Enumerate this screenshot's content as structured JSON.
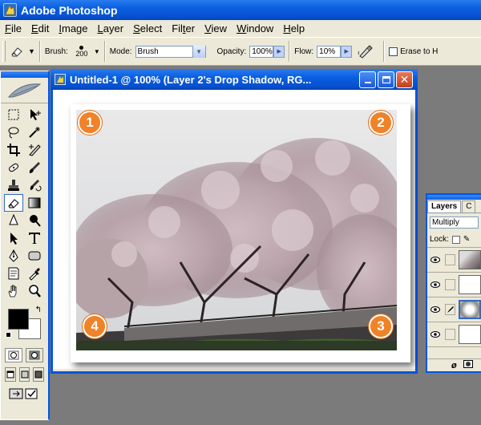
{
  "app": {
    "title": "Adobe Photoshop"
  },
  "menu": [
    {
      "label": "File",
      "u": "F",
      "rest": "ile"
    },
    {
      "label": "Edit",
      "u": "E",
      "rest": "dit"
    },
    {
      "label": "Image",
      "u": "I",
      "rest": "mage"
    },
    {
      "label": "Layer",
      "u": "L",
      "rest": "ayer"
    },
    {
      "label": "Select",
      "u": "S",
      "rest": "elect"
    },
    {
      "label": "Filter",
      "pre": "Fil",
      "u": "t",
      "rest": "er"
    },
    {
      "label": "View",
      "u": "V",
      "rest": "iew"
    },
    {
      "label": "Window",
      "u": "W",
      "rest": "indow"
    },
    {
      "label": "Help",
      "u": "H",
      "rest": "elp"
    }
  ],
  "options": {
    "brush_label": "Brush:",
    "brush_size": "200",
    "mode_label": "Mode:",
    "mode_value": "Brush",
    "opacity_label": "Opacity:",
    "opacity_value": "100%",
    "flow_label": "Flow:",
    "flow_value": "10%",
    "erase_history_label": "Erase to H"
  },
  "document": {
    "title": "Untitled-1 @ 100% (Layer 2's Drop Shadow, RG..."
  },
  "badges": [
    "1",
    "2",
    "3",
    "4"
  ],
  "layers_panel": {
    "tab_layers": "Layers",
    "tab_other": "C",
    "blend_mode": "Multiply",
    "lock_label": "Lock:"
  },
  "colors": {
    "titlebar": "#0a5fe0",
    "badge": "#f08228",
    "chrome": "#ece9d8",
    "workspace": "#7b7b7b"
  }
}
